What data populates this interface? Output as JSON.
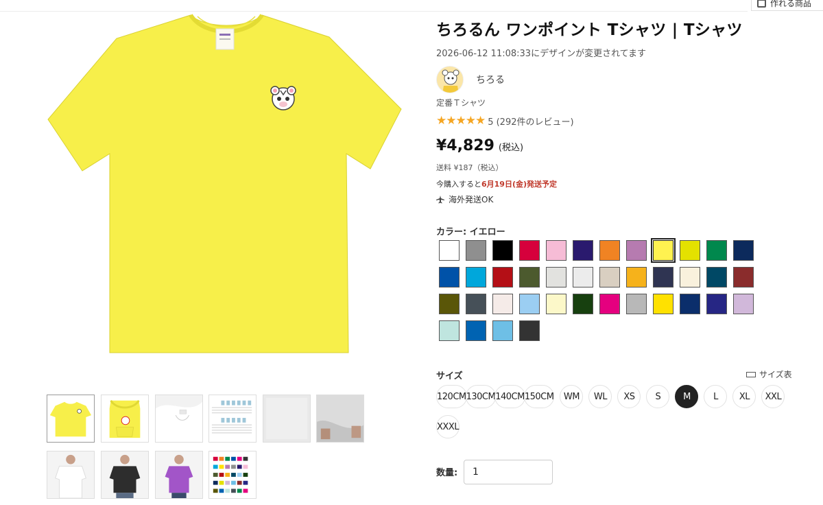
{
  "header": {
    "favorites_label": "作れる商品"
  },
  "product": {
    "title": "ちろるん ワンポイント Tシャツ | Tシャツ",
    "updated_text": "2026-06-12 11:08:33にデザインが変更されてます",
    "creator_name": "ちろる",
    "category": "定番Ｔシャツ",
    "stars": "★★★★★",
    "rating_text": "5 (292件のレビュー)",
    "price": "¥4,829",
    "price_tax": "(税込)",
    "shipping_fee": "送料 ¥187（税込）",
    "ship_prefix": "今購入すると",
    "ship_date": "6月19日(金)発送予定",
    "overseas": "海外発送OK"
  },
  "color": {
    "label": "カラー: イエロー",
    "selected_index": 8,
    "swatches": [
      "#ffffff",
      "#8f8f8f",
      "#000000",
      "#d6003c",
      "#f6bcd6",
      "#2a1a6e",
      "#f08323",
      "#b67bb0",
      "#fff250",
      "#e4e100",
      "#00884d",
      "#0c2a5c",
      "#0052a8",
      "#00a7db",
      "#b40f16",
      "#4c5a2e",
      "#e2e2df",
      "#ececec",
      "#d9cfc1",
      "#f6b21b",
      "#2f3452",
      "#f9f1dd",
      "#004865",
      "#8a2c2c",
      "#5a5608",
      "#465058",
      "#f5ebe8",
      "#9bcef2",
      "#fcf8c9",
      "#17400f",
      "#e5007f",
      "#b8b8b8",
      "#ffe100",
      "#0b2e6b",
      "#262684",
      "#d1b8da",
      "#bfe5df",
      "#0063b2",
      "#6ebfe6",
      "#333333"
    ]
  },
  "size": {
    "label": "サイズ",
    "chart_label": "サイズ表",
    "options": [
      "120CM",
      "130CM",
      "140CM",
      "150CM",
      "WM",
      "WL",
      "XS",
      "S",
      "M",
      "L",
      "XL",
      "XXL",
      "XXXL"
    ],
    "selected": "M"
  },
  "quantity": {
    "label": "数量:",
    "value": "1"
  }
}
